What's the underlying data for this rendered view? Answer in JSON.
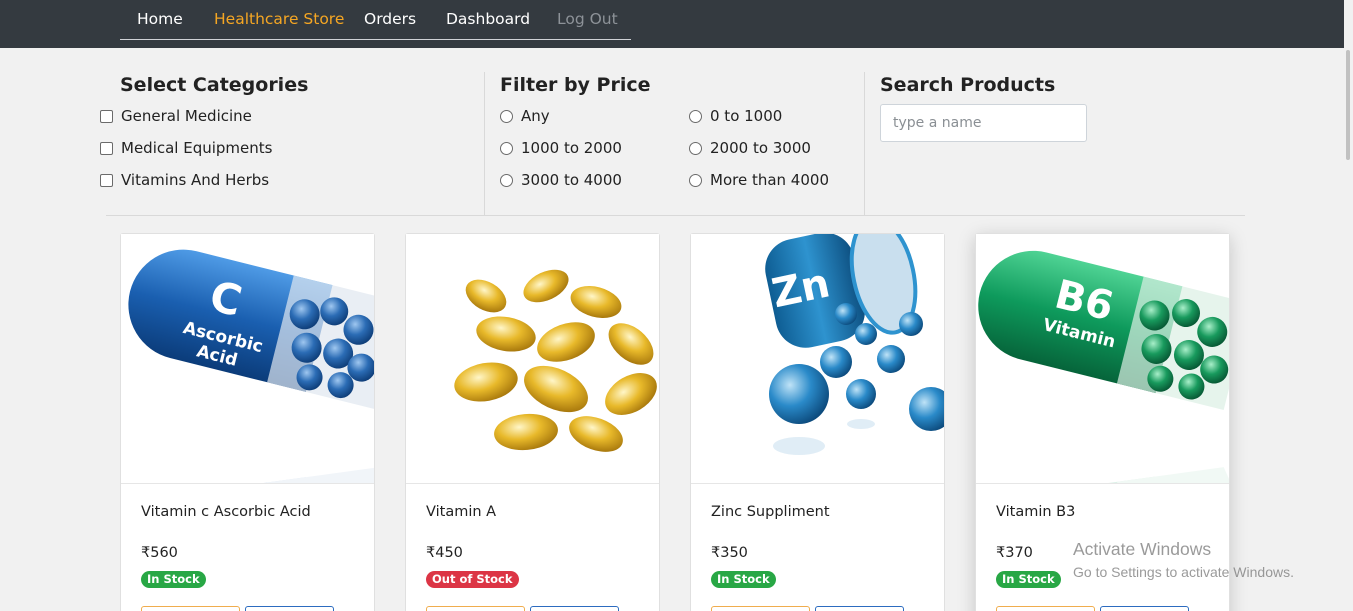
{
  "nav": {
    "items": [
      {
        "label": "Home"
      },
      {
        "label": "Healthcare Store"
      },
      {
        "label": "Orders"
      },
      {
        "label": "Dashboard"
      },
      {
        "label": "Log Out"
      }
    ],
    "active_color": "#f5a623",
    "bg_color": "#343a40"
  },
  "filters": {
    "categories": {
      "title": "Select Categories",
      "options": [
        "General Medicine",
        "Medical Equipments",
        "Vitamins And Herbs"
      ]
    },
    "price": {
      "title": "Filter by Price",
      "options": [
        "Any",
        "0 to 1000",
        "1000 to 2000",
        "2000 to 3000",
        "3000 to 4000",
        "More than 4000"
      ]
    },
    "search": {
      "title": "Search Products",
      "placeholder": "type a name"
    }
  },
  "products": [
    {
      "name": "Vitamin c Ascorbic Acid",
      "price": "₹560",
      "stock": "In Stock",
      "image_text": [
        "C",
        "Ascorbic",
        "Acid"
      ]
    },
    {
      "name": "Vitamin A",
      "price": "₹450",
      "stock": "Out of Stock"
    },
    {
      "name": "Zinc Suppliment",
      "price": "₹350",
      "stock": "In Stock",
      "image_text": [
        "Zn"
      ]
    },
    {
      "name": "Vitamin B3",
      "price": "₹370",
      "stock": "In Stock",
      "image_text": [
        "B6",
        "Vitamin"
      ]
    }
  ],
  "colors": {
    "in_stock": "#28a745",
    "out_of_stock": "#dc3545"
  },
  "watermark": {
    "title": "Activate Windows",
    "subtitle": "Go to Settings to activate Windows."
  }
}
